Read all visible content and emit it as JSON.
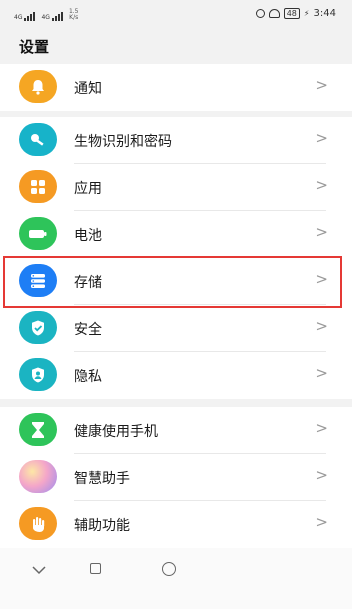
{
  "status_bar": {
    "signal1": "4G",
    "signal2": "4G",
    "speed_value": "1.5",
    "speed_unit": "K/s",
    "battery": "48",
    "time": "3:44"
  },
  "page": {
    "title": "设置"
  },
  "groups": [
    {
      "items": [
        {
          "label": "通知",
          "icon": "bell-icon",
          "color": "#f5a623"
        }
      ]
    },
    {
      "items": [
        {
          "label": "生物识别和密码",
          "icon": "key-icon",
          "color": "#17b3c9"
        },
        {
          "label": "应用",
          "icon": "apps-grid-icon",
          "color": "#f59a23"
        },
        {
          "label": "电池",
          "icon": "battery-icon",
          "color": "#2ec45a"
        },
        {
          "label": "存储",
          "icon": "storage-icon",
          "color": "#1e7ef5"
        },
        {
          "label": "安全",
          "icon": "shield-check-icon",
          "color": "#1bb4c2"
        },
        {
          "label": "隐私",
          "icon": "privacy-shield-icon",
          "color": "#1bb4c2"
        }
      ]
    },
    {
      "items": [
        {
          "label": "健康使用手机",
          "icon": "hourglass-icon",
          "color": "#2ec45a"
        },
        {
          "label": "智慧助手",
          "icon": "assistant-orb-icon",
          "color": "#e98ab8"
        },
        {
          "label": "辅助功能",
          "icon": "hand-icon",
          "color": "#f59a23"
        }
      ]
    }
  ],
  "chevron": ">",
  "navigation_bar": {
    "buttons": [
      "back-icon",
      "recents-icon",
      "home-icon"
    ]
  }
}
